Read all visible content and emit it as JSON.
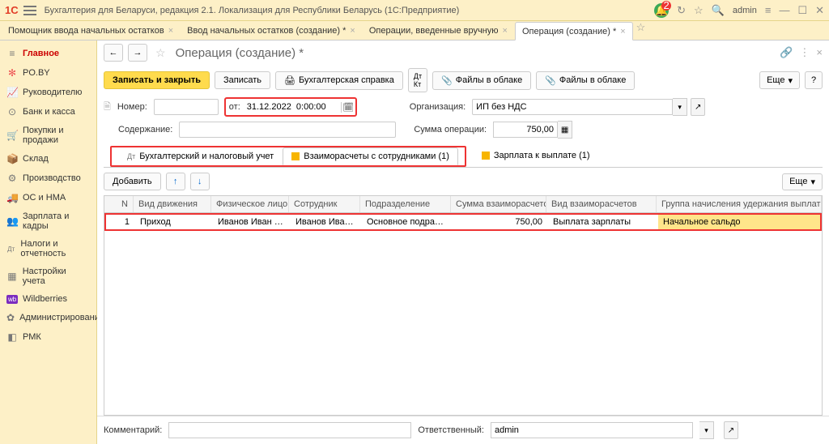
{
  "title": "Бухгалтерия для Беларуси, редакция 2.1. Локализация для Республики Беларусь   (1С:Предприятие)",
  "badge": "2",
  "user": "admin",
  "tabs": [
    {
      "label": "Помощник ввода начальных остатков",
      "active": false
    },
    {
      "label": "Ввод начальных остатков (создание) *",
      "active": false
    },
    {
      "label": "Операции, введенные вручную",
      "active": false
    },
    {
      "label": "Операция (создание) *",
      "active": true
    }
  ],
  "sidebar": [
    {
      "icon": "≡",
      "label": "Главное"
    },
    {
      "icon": "✻",
      "label": "PO.BY"
    },
    {
      "icon": "📈",
      "label": "Руководителю"
    },
    {
      "icon": "⊙",
      "label": "Банк и касса"
    },
    {
      "icon": "🛒",
      "label": "Покупки и продажи"
    },
    {
      "icon": "📦",
      "label": "Склад"
    },
    {
      "icon": "⚙",
      "label": "Производство"
    },
    {
      "icon": "🚚",
      "label": "ОС и НМА"
    },
    {
      "icon": "👥",
      "label": "Зарплата и кадры"
    },
    {
      "icon": "Дт",
      "label": "Налоги и отчетность"
    },
    {
      "icon": "▦",
      "label": "Настройки учета"
    },
    {
      "icon": "wb",
      "label": "Wildberries"
    },
    {
      "icon": "✿",
      "label": "Администрирование"
    },
    {
      "icon": "◧",
      "label": "РМК"
    }
  ],
  "form": {
    "title": "Операция (создание) *",
    "saveClose": "Записать и закрыть",
    "save": "Записать",
    "acctRef": "Бухгалтерская справка",
    "cloud": "Файлы в облаке",
    "more": "Еще",
    "numberLabel": "Номер:",
    "numberValue": "",
    "fromLabel": "от:",
    "dateValue": "31.12.2022  0:00:00",
    "orgLabel": "Организация:",
    "orgValue": "ИП без НДС",
    "contentLabel": "Содержание:",
    "contentValue": "",
    "sumLabel": "Сумма операции:",
    "sumValue": "750,00"
  },
  "subtabs": {
    "t1": "Бухгалтерский и налоговый учет",
    "t2": "Взаиморасчеты с сотрудниками (1)",
    "t3": "Зарплата к выплате (1)"
  },
  "tbtoolbar": {
    "add": "Добавить"
  },
  "grid": {
    "headers": {
      "n": "N",
      "mv": "Вид движения",
      "fl": "Физическое лицо",
      "emp": "Сотрудник",
      "dep": "Подразделение",
      "sum": "Сумма взаиморасчетов",
      "type": "Вид взаиморасчетов",
      "grp": "Группа начисления удержания выплаты"
    },
    "row": {
      "n": "1",
      "mv": "Приход",
      "fl": "Иванов Иван Ива...",
      "emp": "Иванов Иван Ива...",
      "dep": "Основное подразделение",
      "sum": "750,00",
      "type": "Выплата зарплаты",
      "grp": "Начальное сальдо"
    }
  },
  "footer": {
    "cmtLabel": "Комментарий:",
    "cmt": "",
    "respLabel": "Ответственный:",
    "resp": "admin"
  }
}
